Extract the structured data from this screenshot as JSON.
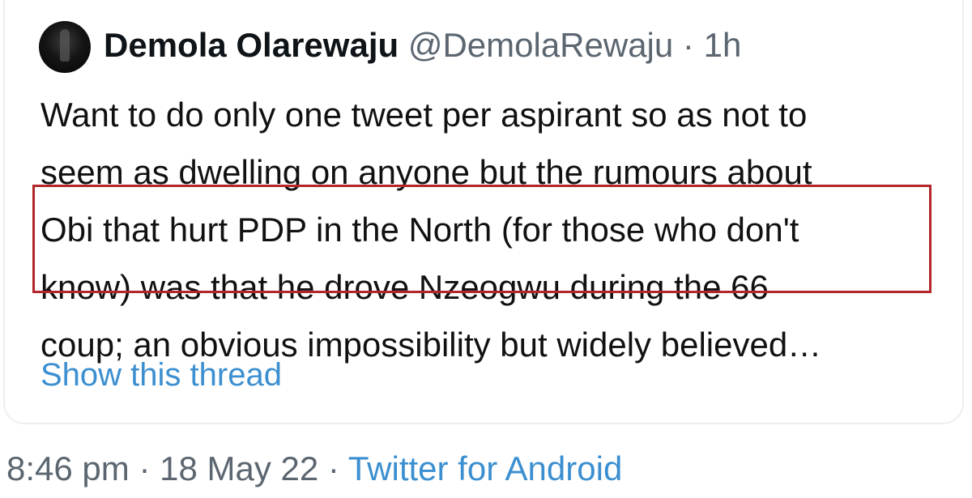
{
  "quoted_tweet": {
    "author": {
      "display_name": "Demola Olarewaju",
      "handle": "@DemolaRewaju",
      "separator": "·",
      "age": "1h"
    },
    "text_lines": [
      "Want to do only one tweet per aspirant so as not to",
      "seem as dwelling on anyone but the rumours about",
      "Obi that hurt PDP in the North (for those who don't",
      "know) was that he drove Nzeogwu during the 66",
      "coup; an obvious impossibility but widely believed…"
    ],
    "show_thread_label": "Show this thread",
    "highlight_color": "#b3262a"
  },
  "tweet_meta": {
    "time": "8:46 pm",
    "separator1": "·",
    "date": "18 May 22",
    "separator2": "·",
    "client": "Twitter for Android"
  },
  "colors": {
    "link": "#3b8fd0",
    "secondary_text": "#5b6670",
    "primary_text": "#0f1419"
  }
}
